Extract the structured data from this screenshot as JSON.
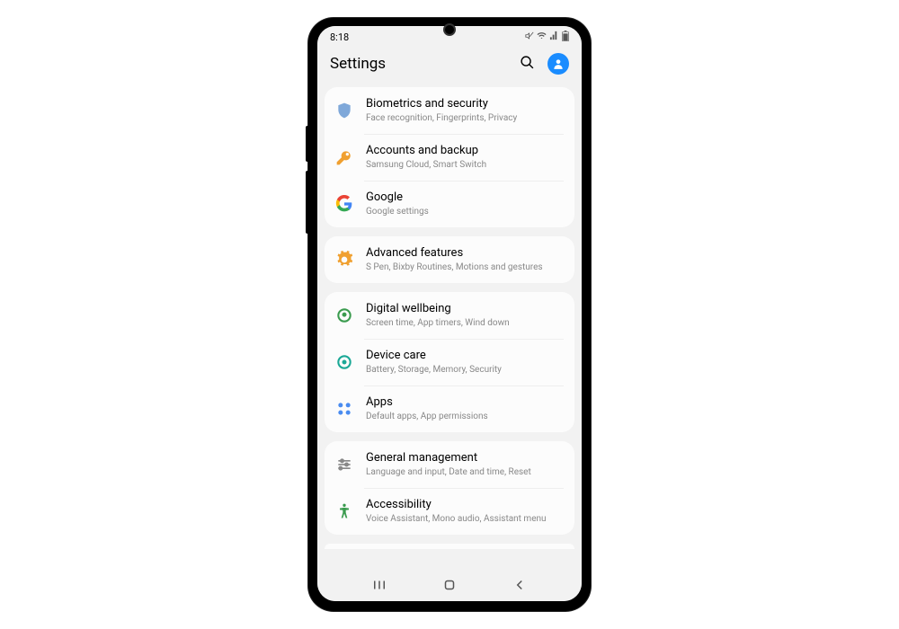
{
  "status": {
    "time": "8:18"
  },
  "header": {
    "title": "Settings"
  },
  "groups": [
    {
      "items": [
        {
          "title": "Biometrics and security",
          "subtitle": "Face recognition, Fingerprints, Privacy"
        },
        {
          "title": "Accounts and backup",
          "subtitle": "Samsung Cloud, Smart Switch"
        },
        {
          "title": "Google",
          "subtitle": "Google settings"
        }
      ]
    },
    {
      "items": [
        {
          "title": "Advanced features",
          "subtitle": "S Pen, Bixby Routines, Motions and gestures"
        }
      ]
    },
    {
      "items": [
        {
          "title": "Digital wellbeing",
          "subtitle": "Screen time, App timers, Wind down"
        },
        {
          "title": "Device care",
          "subtitle": "Battery, Storage, Memory, Security"
        },
        {
          "title": "Apps",
          "subtitle": "Default apps, App permissions"
        }
      ]
    },
    {
      "items": [
        {
          "title": "General management",
          "subtitle": "Language and input, Date and time, Reset"
        },
        {
          "title": "Accessibility",
          "subtitle": "Voice Assistant, Mono audio, Assistant menu"
        }
      ]
    }
  ]
}
